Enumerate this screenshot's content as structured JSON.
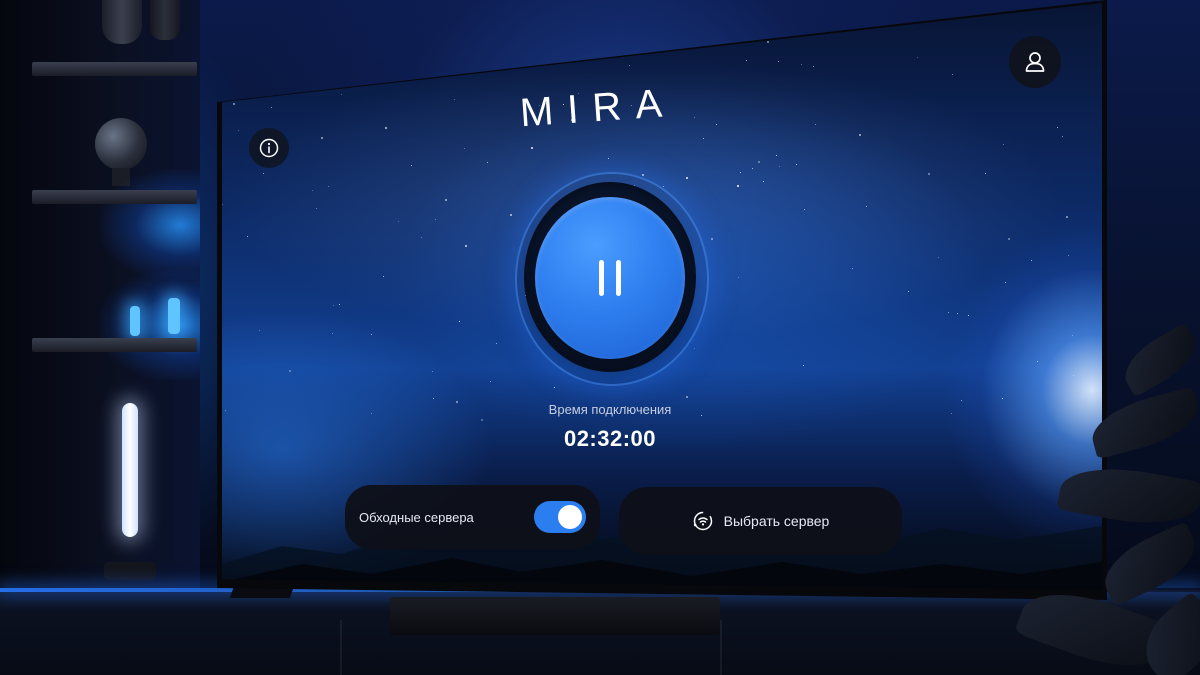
{
  "app": {
    "brand": "MIRA"
  },
  "header": {
    "info_icon": "info-icon",
    "profile_icon": "user-icon"
  },
  "connection": {
    "state_icon": "pause-icon",
    "label": "Время подключения",
    "time": "02:32:00"
  },
  "bypass": {
    "label": "Обходные сервера",
    "enabled": true
  },
  "server": {
    "icon": "server-select-icon",
    "label": "Выбрать сервер"
  },
  "colors": {
    "accent": "#2f7ff0",
    "card_bg": "#0e1018",
    "text": "#e6e9f2"
  }
}
